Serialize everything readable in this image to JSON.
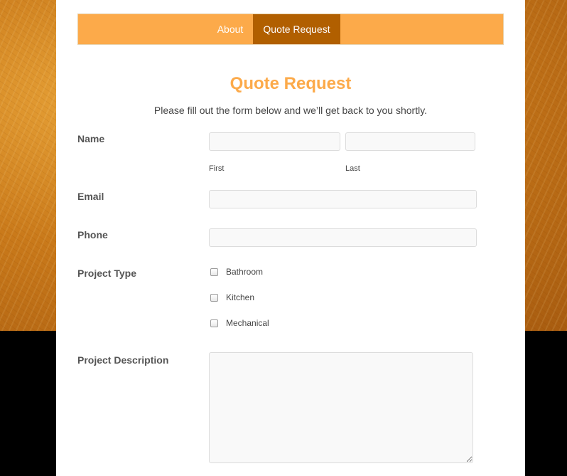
{
  "nav": {
    "items": [
      {
        "label": "About",
        "active": false
      },
      {
        "label": "Quote Request",
        "active": true
      }
    ]
  },
  "header": {
    "title": "Quote Request",
    "subtitle": "Please fill out the form below and we’ll get back to you shortly."
  },
  "form": {
    "name": {
      "label": "Name",
      "first_sublabel": "First",
      "last_sublabel": "Last",
      "first_value": "",
      "last_value": ""
    },
    "email": {
      "label": "Email",
      "value": ""
    },
    "phone": {
      "label": "Phone",
      "value": ""
    },
    "project_type": {
      "label": "Project Type",
      "options": [
        {
          "label": "Bathroom",
          "checked": false
        },
        {
          "label": "Kitchen",
          "checked": false
        },
        {
          "label": "Mechanical",
          "checked": false
        }
      ]
    },
    "description": {
      "label": "Project Description",
      "value": ""
    }
  },
  "colors": {
    "accent": "#fcaa4a",
    "nav_active": "#b15f00",
    "label_text": "#555555"
  }
}
